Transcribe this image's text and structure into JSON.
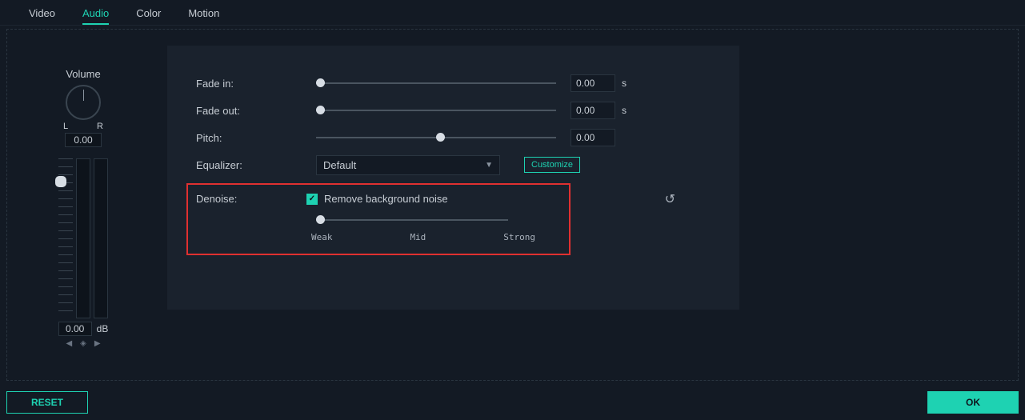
{
  "tabs": {
    "video": "Video",
    "audio": "Audio",
    "color": "Color",
    "motion": "Motion"
  },
  "volume": {
    "title": "Volume",
    "left": "L",
    "right": "R",
    "pan_value": "0.00",
    "db_value": "0.00",
    "db_unit": "dB"
  },
  "fade_in": {
    "label": "Fade in:",
    "value": "0.00",
    "unit": "s",
    "pos_pct": 0
  },
  "fade_out": {
    "label": "Fade out:",
    "value": "0.00",
    "unit": "s",
    "pos_pct": 0
  },
  "pitch": {
    "label": "Pitch:",
    "value": "0.00",
    "pos_pct": 50
  },
  "equalizer": {
    "label": "Equalizer:",
    "selected": "Default",
    "customize": "Customize"
  },
  "denoise": {
    "label": "Denoise:",
    "checkbox_label": "Remove background noise",
    "checked": true,
    "weak": "Weak",
    "mid": "Mid",
    "strong": "Strong",
    "pos_pct": 0
  },
  "buttons": {
    "reset": "RESET",
    "ok": "OK"
  }
}
